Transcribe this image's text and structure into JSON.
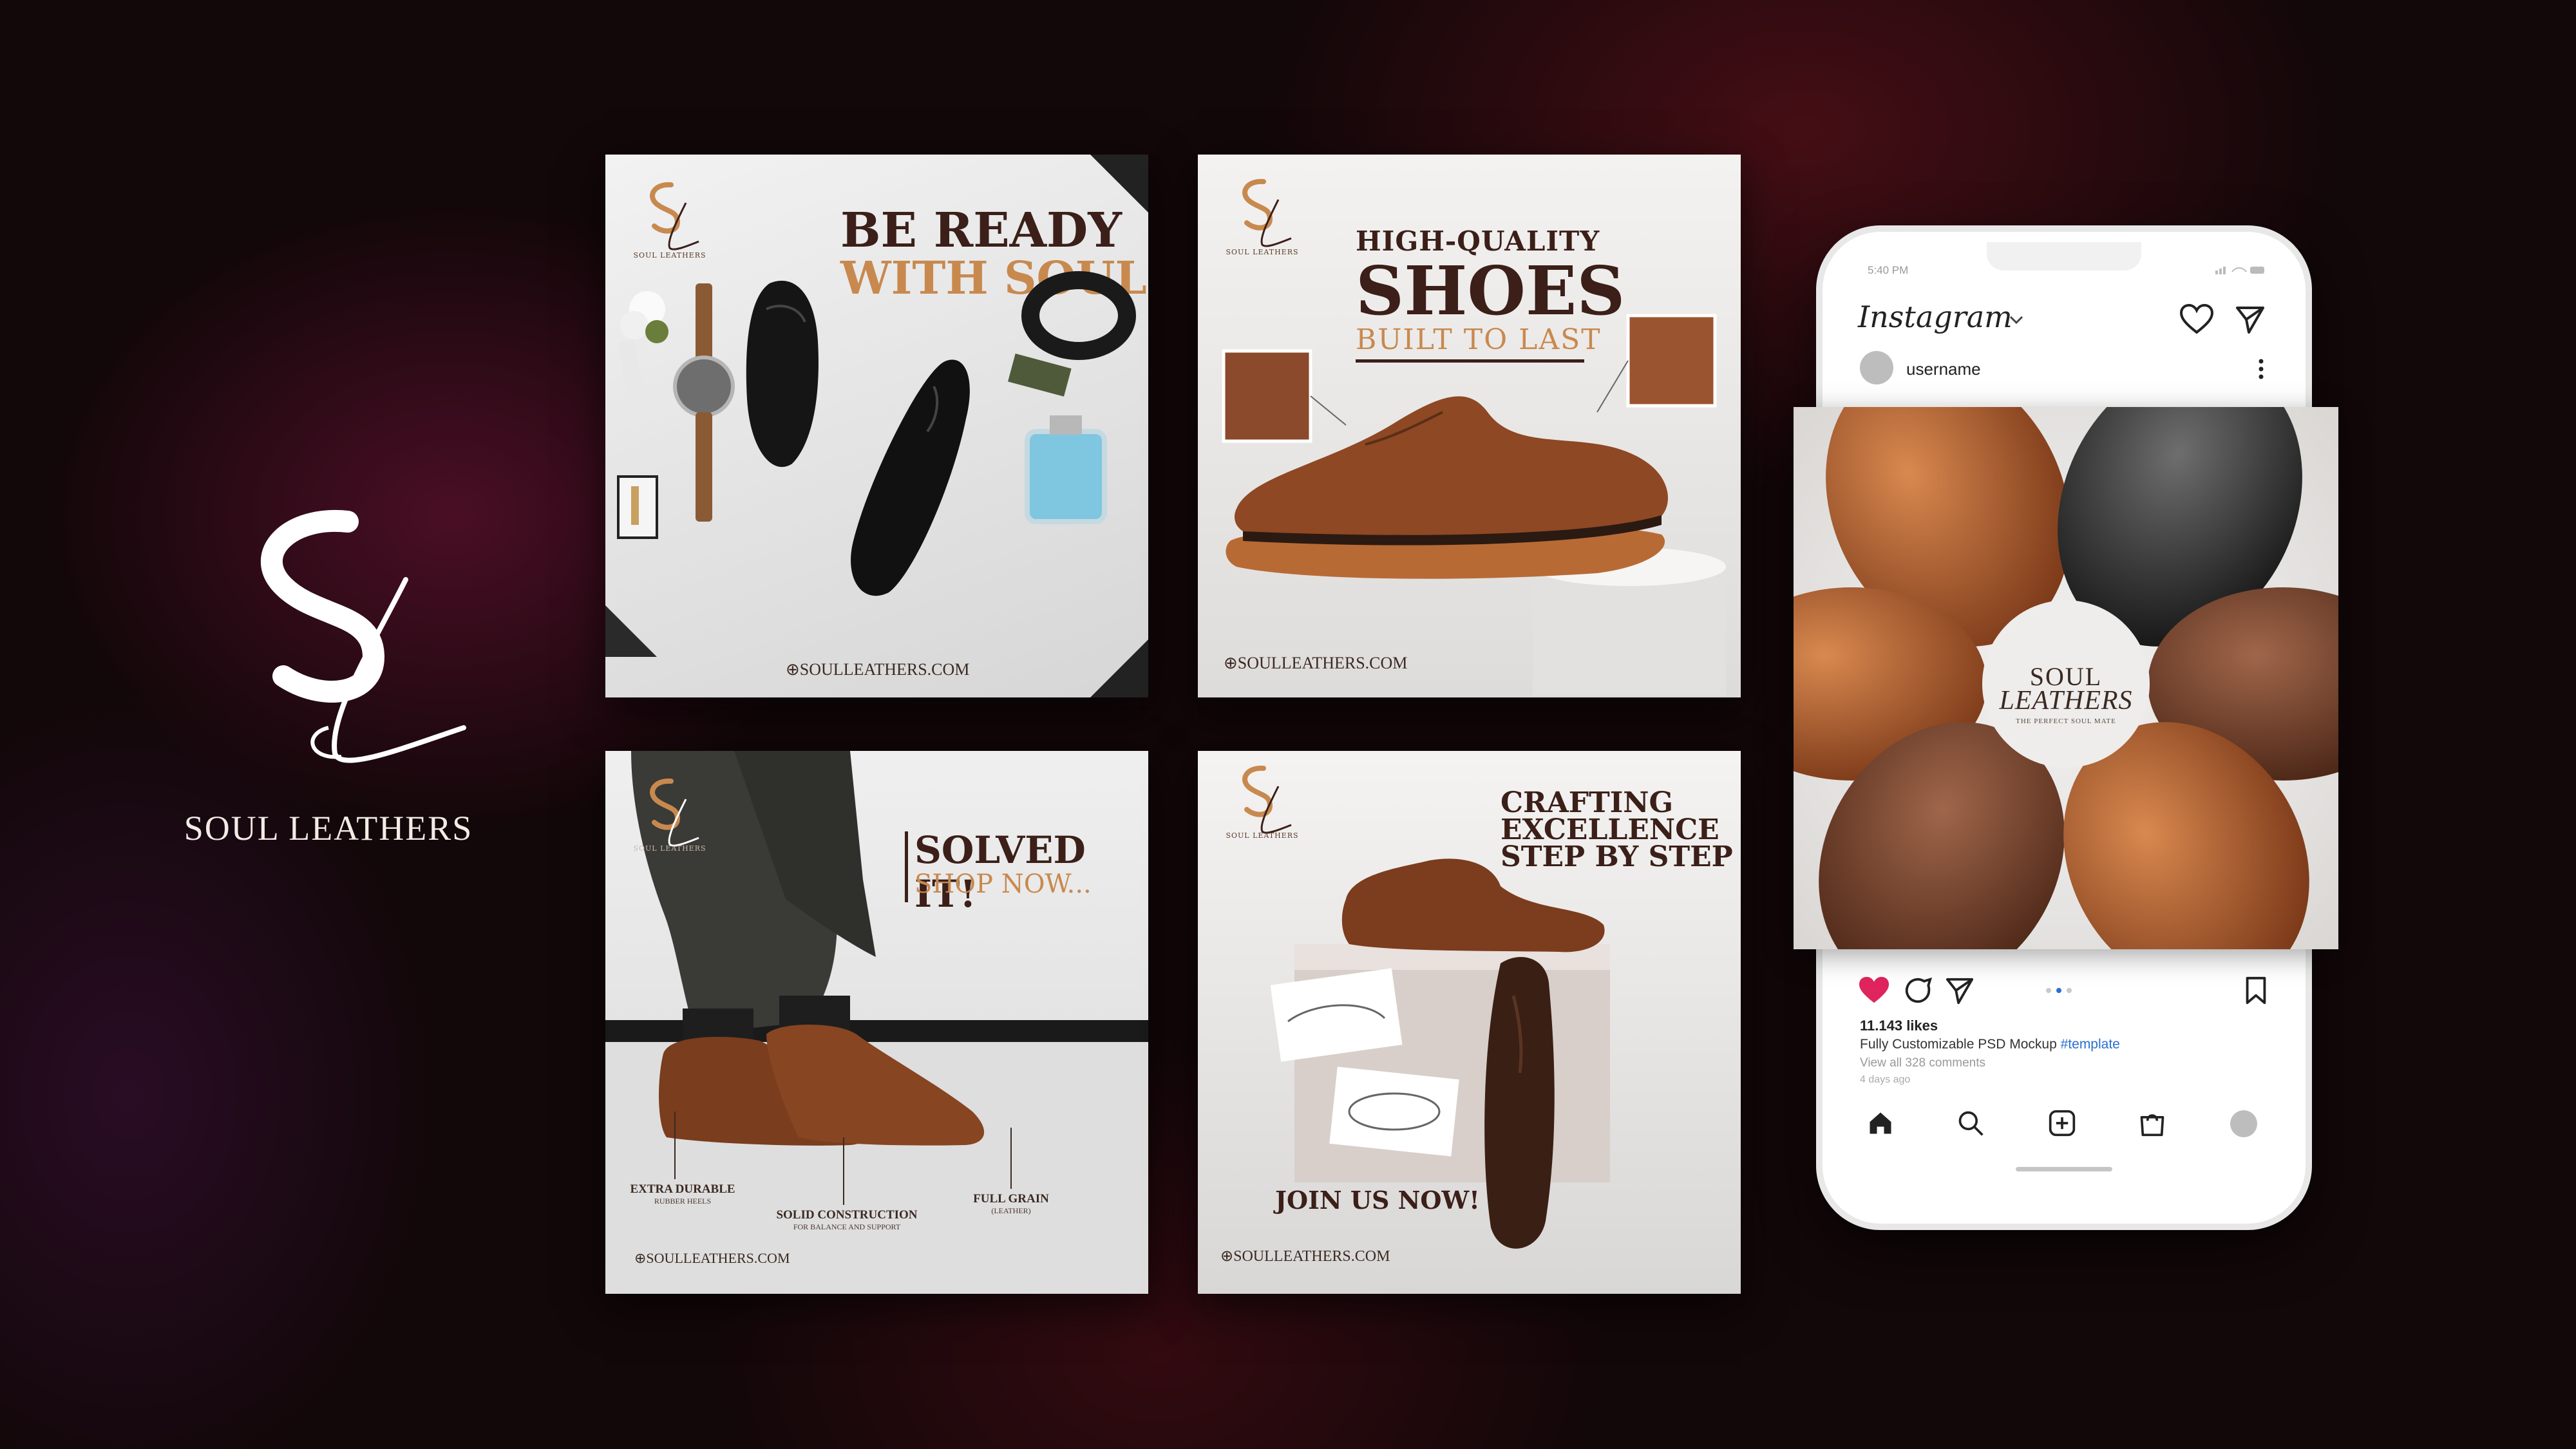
{
  "brand": {
    "name": "SOUL LEATHERS",
    "monogram": "SL"
  },
  "posts": [
    {
      "headline_dark": "BE READY",
      "headline_gold": "WITH SOUL",
      "logo_caption": "SOUL LEATHERS",
      "site": "⊕SOULLEATHERS.COM"
    },
    {
      "kicker": "HIGH-QUALITY",
      "headline_dark": "SHOES",
      "headline_gold": "BUILT TO LAST",
      "logo_caption": "SOUL LEATHERS",
      "site": "⊕SOULLEATHERS.COM"
    },
    {
      "headline_dark": "SOLVED IT!",
      "headline_gold": "SHOP NOW...",
      "logo_caption": "SOUL LEATHERS",
      "site": "⊕SOULLEATHERS.COM",
      "callouts": [
        {
          "title": "EXTRA DURABLE",
          "sub": "RUBBER HEELS"
        },
        {
          "title": "SOLID CONSTRUCTION",
          "sub": "FOR BALANCE AND SUPPORT"
        },
        {
          "title": "FULL GRAIN",
          "sub": "(LEATHER)"
        }
      ]
    },
    {
      "headline_lines": [
        "CRAFTING",
        "EXCELLENCE",
        "STEP BY STEP"
      ],
      "cta": "JOIN US NOW!",
      "logo_caption": "SOUL LEATHERS",
      "site": "⊕SOULLEATHERS.COM"
    }
  ],
  "phone": {
    "time": "5:40 PM",
    "app_name": "Instagram",
    "username": "username",
    "image_brand_top": "SOUL",
    "image_brand_bottom": "LEATHERS",
    "image_tagline": "THE PERFECT SOUL MATE",
    "likes": "11.143 likes",
    "caption": "Fully Customizable PSD Mockup",
    "hashtag": "#template",
    "comments": "View all 328 comments",
    "time_ago": "4 days ago"
  },
  "colors": {
    "gold": "#c8894f",
    "dark_brown": "#3b1f18",
    "accent_blue": "#2a6fd1",
    "like_red": "#e0245e"
  }
}
